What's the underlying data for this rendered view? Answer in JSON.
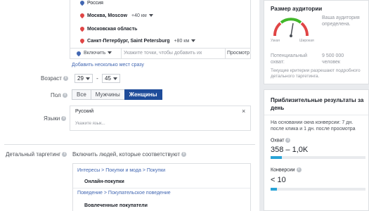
{
  "locations": [
    {
      "name": "Россия",
      "pin": "pin-blue-icon",
      "radius": ""
    },
    {
      "name": "Москва, Moscow",
      "pin": "pin-red-icon",
      "radius": "+40 км"
    },
    {
      "name": "Московская область",
      "pin": "pin-red-icon",
      "radius": ""
    },
    {
      "name": "Санкт-Петербург, Saint Petersburg",
      "pin": "pin-red-icon",
      "radius": "+80 км"
    }
  ],
  "location_bar": {
    "include_label": "Включить",
    "placeholder": "Укажите точки, чтобы добавить их",
    "browse_label": "Просмотр"
  },
  "bulk_add_link": "Добавить несколько мест сразу",
  "age": {
    "label": "Возраст",
    "from": "29",
    "dash": "-",
    "to": "45"
  },
  "gender": {
    "label": "Пол",
    "options": [
      "Все",
      "Мужчины",
      "Женщины"
    ],
    "selected": "Женщины"
  },
  "languages": {
    "label": "Языки",
    "value": "Русский",
    "placeholder": "Укажите язык..."
  },
  "detailed": {
    "label": "Детальный таргетинг",
    "description": "Включить людей, которые соответствуют",
    "groups": [
      {
        "path": "Интересы > Покупки и мода > Покупки",
        "item": "Онлайн-покупки"
      },
      {
        "path": "Поведение > Покупательское поведение",
        "item": "Вовлеченные покупатели"
      }
    ]
  },
  "audience": {
    "title": "Размер аудитории",
    "gauge_low": "Узкая",
    "gauge_high": "Широкая",
    "status": "Ваша аудитория определена.",
    "potential_label": "Потенциальный охват:",
    "potential_value": "9 500 000 человек",
    "note": "Текущие критерии разрешают подробного детального таргетинга."
  },
  "estimates": {
    "title": "Приблизительные результаты за день",
    "description": "На основании окна конверсии: 7 дн. после клика и 1 дн. после просмотра",
    "reach_label": "Охват",
    "reach_value": "358 – 1,0K",
    "conv_label": "Конверсии",
    "conv_value": "< 10"
  },
  "colors": {
    "accent": "#4267b2",
    "selected": "#1e4c9a",
    "pin_red": "#e04545",
    "pin_blue": "#4267b2",
    "bar": "#29a3d6",
    "gauge_green": "#42b72a"
  }
}
